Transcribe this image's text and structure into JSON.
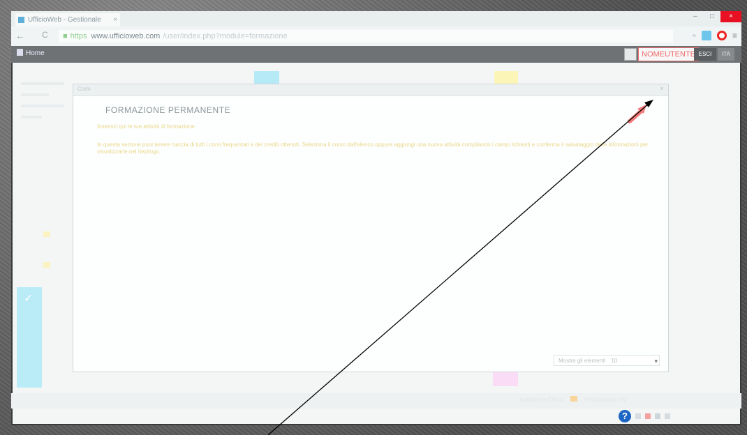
{
  "browser": {
    "tab_title": "UfficioWeb - Gestionale",
    "tab_close": "×",
    "window_controls": [
      "–",
      "□",
      "×"
    ],
    "back": "←",
    "reload": "C",
    "url_scheme": "https",
    "url_host": "www.ufficioweb.com",
    "url_path": "/user/index.php?module=formazione"
  },
  "app_header": {
    "home_label": "Home",
    "user_name": "NOMEUTENTE",
    "logout_label": "ESCI",
    "lang_label": "ITA"
  },
  "modal": {
    "header_label": "Corsi",
    "close_glyph": "×",
    "title": "FORMAZIONE PERMANENTE",
    "paragraph1": "Inserisci qui le tue attività di formazione.",
    "paragraph2": "In questa sezione puoi tenere traccia di tutti i corsi frequentati e dei crediti ottenuti. Seleziona il corso dall'elenco oppure aggiungi una nuova attività compilando i campi richiesti e conferma il salvataggio delle informazioni per visualizzarle nel riepilogo.",
    "select_label": "Mostra gli elementi",
    "select_value": "10",
    "select_caret": "▾"
  },
  "status_bar": {
    "text": "Assistenza Clienti",
    "text2": "Fatturazione ON",
    "help_glyph": "?"
  },
  "colors": {
    "accent_red": "#f06b6b",
    "header_gray": "#6f7275",
    "help_blue": "#1e66c4",
    "body_text_yellow": "#e9d88a"
  }
}
